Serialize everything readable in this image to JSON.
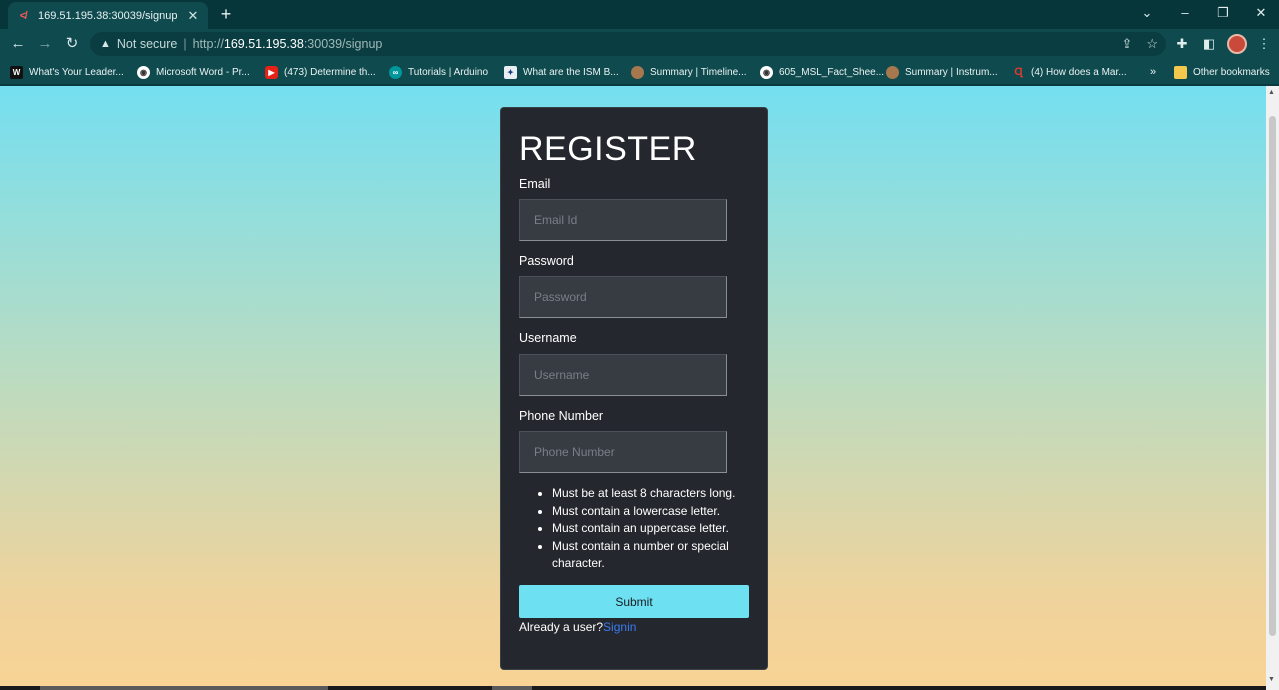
{
  "browser": {
    "tab": {
      "title": "169.51.195.38:30039/signup",
      "favicon": "red-app-icon"
    },
    "new_tab": "+",
    "window_controls": {
      "dropdown": "⌄",
      "minimize": "–",
      "restore": "❐",
      "close": "✕"
    },
    "nav": {
      "back": "←",
      "forward": "→",
      "reload": "↻"
    },
    "address": {
      "security": "Not secure",
      "separator": "|",
      "scheme": "http://",
      "host": "169.51.195.38",
      "path": ":30039/signup"
    },
    "bookmarks": [
      {
        "label": "What's Your Leader...",
        "icon": "W"
      },
      {
        "label": "Microsoft Word - Pr...",
        "icon": "globe"
      },
      {
        "label": "(473) Determine th...",
        "icon": "youtube"
      },
      {
        "label": "Tutorials | Arduino",
        "icon": "arduino"
      },
      {
        "label": "What are the ISM B...",
        "icon": "ism"
      },
      {
        "label": "Summary | Timeline...",
        "icon": "avatar"
      },
      {
        "label": "605_MSL_Fact_Shee...",
        "icon": "globe"
      },
      {
        "label": "Summary | Instrum...",
        "icon": "avatar"
      },
      {
        "label": "(4) How does a Mar...",
        "icon": "quora"
      }
    ],
    "bookmarks_more": "»",
    "other_bookmarks": "Other bookmarks"
  },
  "form": {
    "title": "REGISTER",
    "email_label": "Email",
    "email_placeholder": "Email Id",
    "password_label": "Password",
    "password_placeholder": "Password",
    "username_label": "Username",
    "username_placeholder": "Username",
    "phone_label": "Phone Number",
    "phone_placeholder": "Phone Number",
    "rules": [
      "Must be at least 8 characters long.",
      "Must contain a lowercase letter.",
      "Must contain an uppercase letter.",
      "Must contain a number or special character."
    ],
    "submit_label": "Submit",
    "already_text": "Already a user?",
    "signin_link": "Signin"
  },
  "colors": {
    "card_bg": "#24272d",
    "submit_bg": "#6de0f2",
    "link": "#3b7bf0",
    "gradient_top": "#74dff0",
    "gradient_bottom": "#f8d395"
  }
}
